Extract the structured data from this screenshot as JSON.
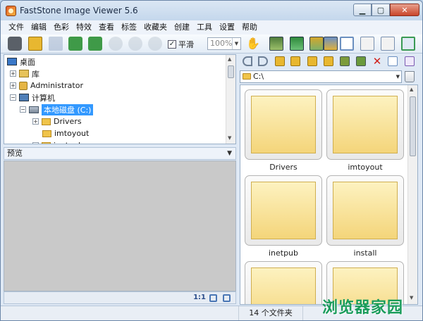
{
  "window": {
    "title": "FastStone Image Viewer 5.6"
  },
  "menu": [
    "文件",
    "编辑",
    "色彩",
    "特效",
    "查看",
    "标签",
    "收藏夹",
    "创建",
    "工具",
    "设置",
    "帮助"
  ],
  "toolbar": {
    "smooth_label": "平滑",
    "smooth_checked": "✓",
    "zoom_value": "100%"
  },
  "tree": {
    "items": [
      {
        "label": "桌面"
      },
      {
        "label": "库"
      },
      {
        "label": "Administrator"
      },
      {
        "label": "计算机"
      },
      {
        "label": "本地磁盘 (C:)"
      },
      {
        "label": "Drivers"
      },
      {
        "label": "imtoyout"
      },
      {
        "label": "inetpub"
      }
    ]
  },
  "preview": {
    "label": "预览",
    "ratio": "1:1"
  },
  "browser": {
    "path": "C:\\",
    "thumbnails": [
      "Drivers",
      "imtoyout",
      "inetpub",
      "install",
      "",
      ""
    ]
  },
  "status": {
    "count": "14 个文件夹"
  },
  "watermark": "浏览器家园",
  "colors": {
    "selection": "#3399ff",
    "folder_thumb": "#f4d57a",
    "preview_bg": "#c9c9c9"
  }
}
